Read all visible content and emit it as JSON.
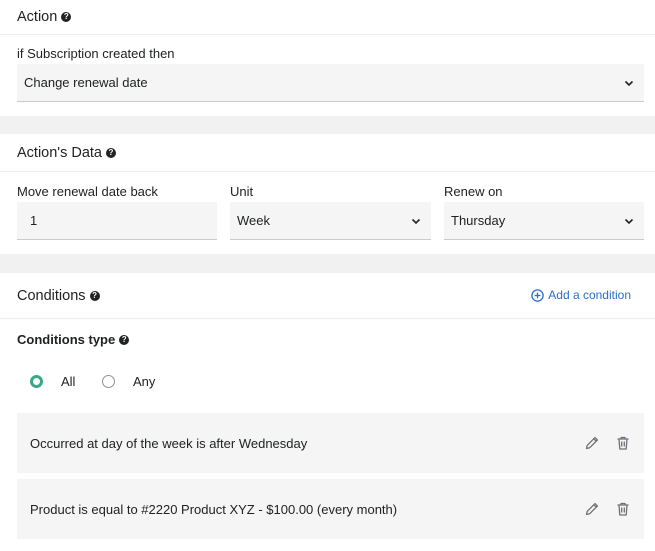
{
  "action": {
    "title": "Action",
    "trigger_label": "if Subscription created then",
    "selected_action": "Change renewal date"
  },
  "actions_data": {
    "title": "Action's Data",
    "move_label": "Move renewal date back",
    "move_value": "1",
    "unit_label": "Unit",
    "unit_value": "Week",
    "renew_label": "Renew on",
    "renew_value": "Thursday"
  },
  "conditions": {
    "title": "Conditions",
    "add_label": "Add a condition",
    "type_label": "Conditions type",
    "options": [
      {
        "label": "All",
        "selected": true
      },
      {
        "label": "Any",
        "selected": false
      }
    ],
    "rows": [
      {
        "text": "Occurred at day of the week is after Wednesday"
      },
      {
        "text": "Product is equal to #2220 Product XYZ - $100.00 (every month)"
      }
    ]
  },
  "colors": {
    "accent_green": "#3aa889",
    "link_blue": "#2c6ecb"
  },
  "icons": [
    "help-icon",
    "chevron-down-icon",
    "plus-circle-icon",
    "pencil-icon",
    "trash-icon"
  ]
}
